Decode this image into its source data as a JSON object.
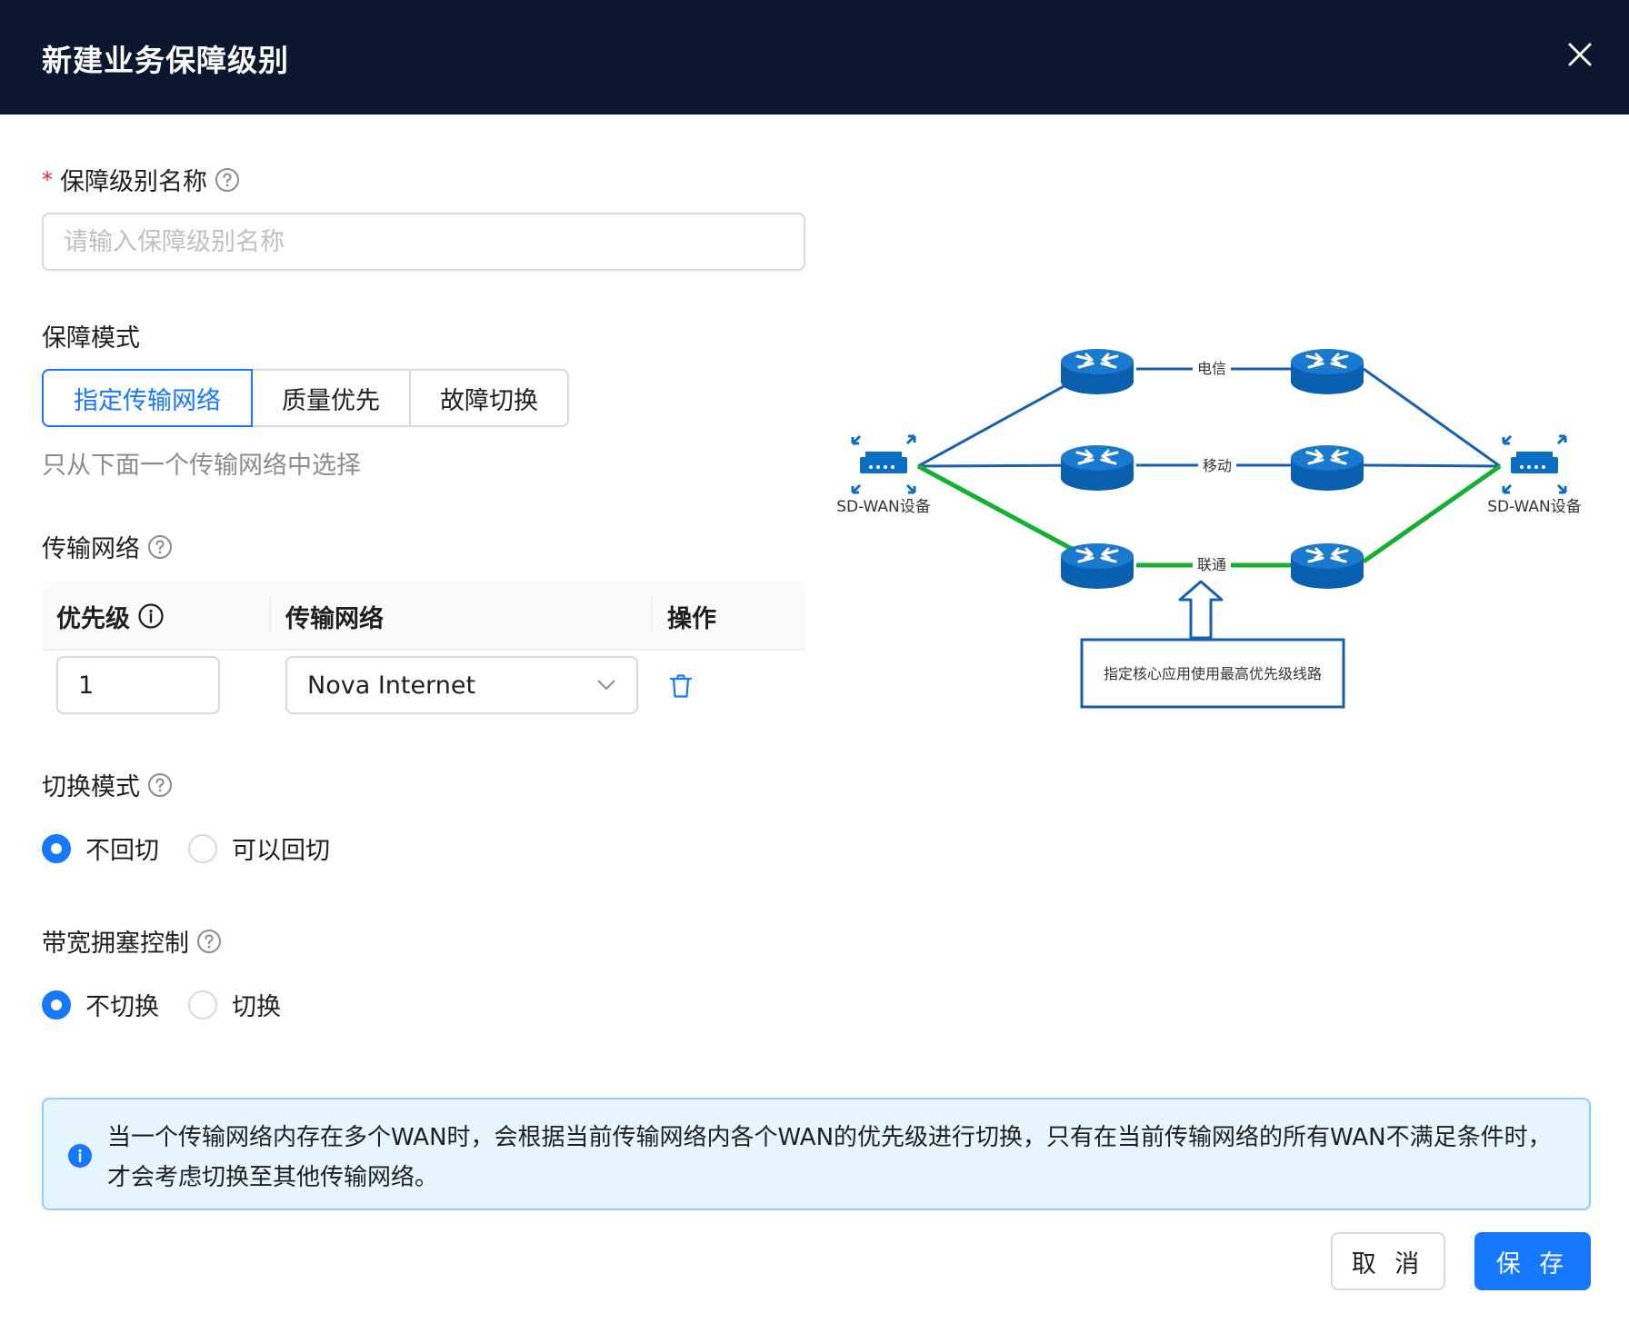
{
  "dialog": {
    "title": "新建业务保障级别"
  },
  "form": {
    "name_field": {
      "label": "保障级别名称",
      "placeholder": "请输入保障级别名称",
      "value": ""
    },
    "mode": {
      "label": "保障模式",
      "options": [
        "指定传输网络",
        "质量优先",
        "故障切换"
      ],
      "selected": "指定传输网络",
      "hint": "只从下面一个传输网络中选择"
    },
    "network": {
      "label": "传输网络",
      "columns": [
        "优先级",
        "传输网络",
        "操作"
      ],
      "rows": [
        {
          "priority": "1",
          "network": "Nova Internet"
        }
      ]
    },
    "switch_mode": {
      "label": "切换模式",
      "options": [
        "不回切",
        "可以回切"
      ],
      "selected": "不回切"
    },
    "congestion": {
      "label": "带宽拥塞控制",
      "options": [
        "不切换",
        "切换"
      ],
      "selected": "不切换"
    }
  },
  "diagram": {
    "device_left": "SD-WAN设备",
    "device_right": "SD-WAN设备",
    "line_labels": [
      "电信",
      "移动",
      "联通"
    ],
    "callout": "指定核心应用使用最高优先级线路",
    "colors": {
      "router": "#0a6fc2",
      "line": "#1560b0",
      "highlight": "#14b030"
    }
  },
  "alert": {
    "text": "当一个传输网络内存在多个WAN时，会根据当前传输网络内各个WAN的优先级进行切换，只有在当前传输网络的所有WAN不满足条件时，才会考虑切换至其他传输网络。"
  },
  "footer": {
    "cancel": "取 消",
    "save": "保 存"
  },
  "colors": {
    "header_bg": "#0c1830",
    "primary": "#1677ff",
    "alert_bg": "#e6f4ff"
  }
}
